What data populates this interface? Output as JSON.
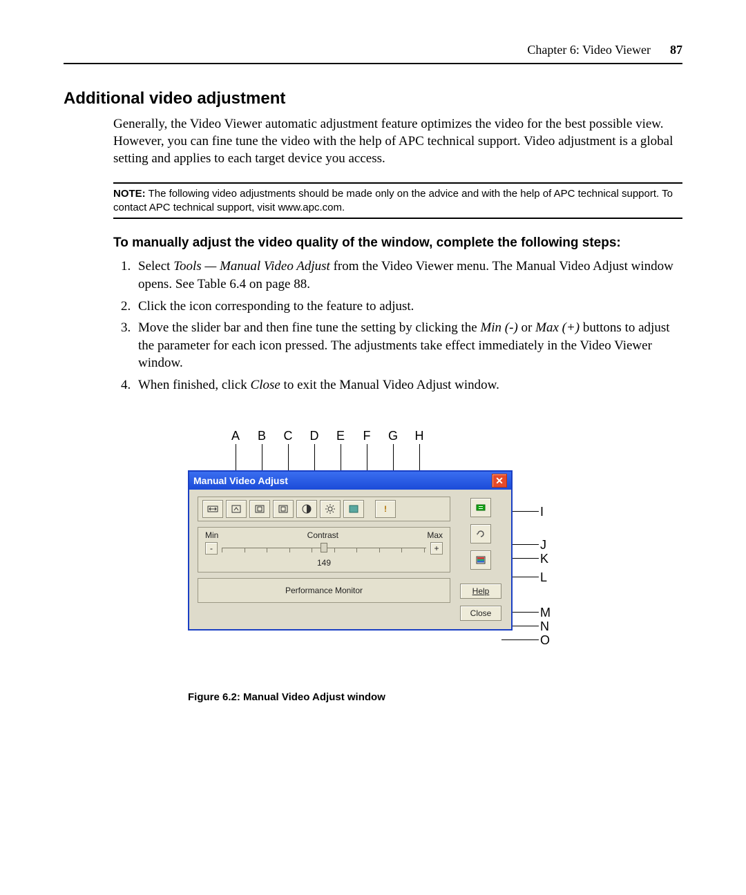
{
  "header": {
    "chapter": "Chapter 6: Video Viewer",
    "page": "87"
  },
  "section_title": "Additional video adjustment",
  "intro": "Generally, the Video Viewer automatic adjustment feature optimizes the video for the best possible view. However, you can fine tune the video with the help of APC technical support. Video adjustment is a global setting and applies to each target device you access.",
  "note": {
    "label": "NOTE:",
    "text": " The following video adjustments should be made only on the advice and with the help of APC technical support. To contact APC technical support, visit www.apc.com."
  },
  "subhead": "To manually adjust the video quality of the window, complete the following steps:",
  "steps": {
    "s1a": "Select ",
    "s1i": "Tools — Manual Video Adjust",
    "s1b": " from the Video Viewer menu. The Manual Video Adjust window opens. See Table 6.4 on page 88.",
    "s2": "Click the icon corresponding to the feature to adjust.",
    "s3a": "Move the slider bar and then fine tune the setting by clicking the ",
    "s3i1": "Min (-)",
    "s3b": " or ",
    "s3i2": "Max (+)",
    "s3c": " buttons to adjust the parameter for each icon pressed. The adjustments take effect immediately in the Video Viewer window.",
    "s4a": "When finished, click ",
    "s4i": "Close",
    "s4b": " to exit the Manual Video Adjust window."
  },
  "callouts": {
    "top": [
      "A",
      "B",
      "C",
      "D",
      "E",
      "F",
      "G",
      "H"
    ],
    "right": {
      "I": "I",
      "J": "J",
      "K": "K",
      "L": "L",
      "M": "M",
      "N": "N",
      "O": "O"
    }
  },
  "window": {
    "title": "Manual Video Adjust",
    "slider": {
      "min": "Min",
      "label": "Contrast",
      "max": "Max",
      "minus": "-",
      "plus": "+",
      "value": "149"
    },
    "perf": "Performance Monitor",
    "help": "Help",
    "close": "Close"
  },
  "caption": "Figure 6.2: Manual Video Adjust window"
}
